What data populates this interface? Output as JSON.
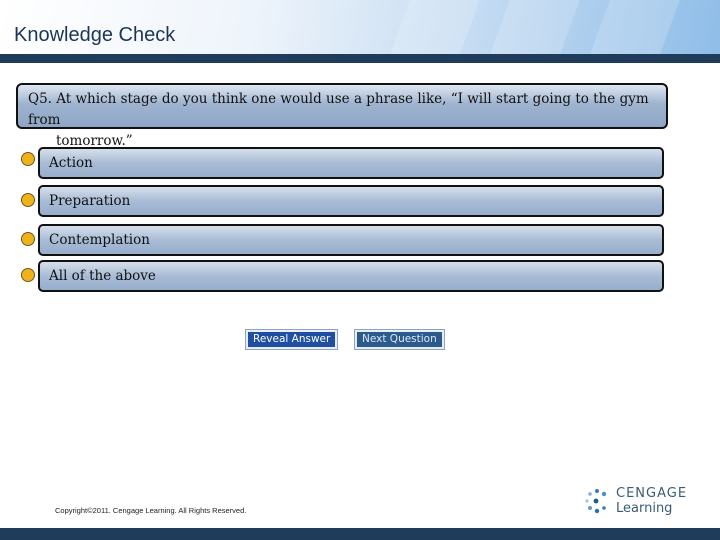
{
  "header": {
    "title": "Knowledge Check"
  },
  "question": {
    "line1": "Q5. At which stage do you think one would use a phrase like, “I will start going to the gym from",
    "line2": "tomorrow.”"
  },
  "options": [
    {
      "label": "Action"
    },
    {
      "label": "Preparation"
    },
    {
      "label": "Contemplation"
    },
    {
      "label": "All of the above"
    }
  ],
  "buttons": {
    "reveal_label": "Reveal Answer",
    "next_label": "Next Question"
  },
  "footer": {
    "copyright": "Copyright©2011. Cengage Learning. All Rights Reserved.",
    "logo_brand": "CENGAGE",
    "logo_sub": "Learning"
  },
  "colors": {
    "header_bar": "#1f3c5a",
    "radio": "#f0b21a",
    "reveal_button": "#1f4ea3",
    "next_button": "#2b5a8e"
  }
}
